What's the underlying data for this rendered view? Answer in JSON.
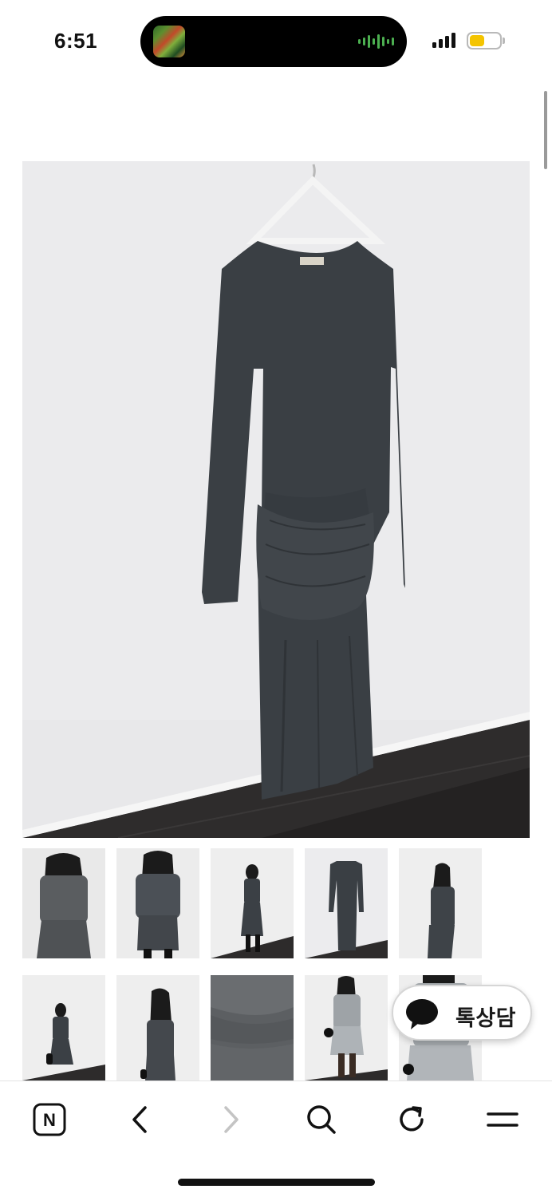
{
  "status_bar": {
    "time": "6:51"
  },
  "product": {
    "main_image_alt": "",
    "thumbnails": [
      {
        "name": "thumb-1"
      },
      {
        "name": "thumb-2"
      },
      {
        "name": "thumb-3"
      },
      {
        "name": "thumb-4"
      },
      {
        "name": "thumb-5"
      },
      {
        "name": "thumb-6"
      },
      {
        "name": "thumb-7"
      },
      {
        "name": "thumb-8"
      },
      {
        "name": "thumb-9"
      },
      {
        "name": "thumb-10"
      }
    ]
  },
  "chat_button": {
    "label": "톡상담",
    "icon": "speech-bubble-icon"
  },
  "toolbar": {
    "items": [
      {
        "icon": "naver-home-icon",
        "label": "N"
      },
      {
        "icon": "back-icon"
      },
      {
        "icon": "forward-icon",
        "disabled": true
      },
      {
        "icon": "search-icon"
      },
      {
        "icon": "refresh-icon"
      },
      {
        "icon": "menu-icon"
      }
    ]
  },
  "colors": {
    "battery": "#f4c400",
    "audio_wave": "#4caf50",
    "dress": "#3a3f44"
  }
}
